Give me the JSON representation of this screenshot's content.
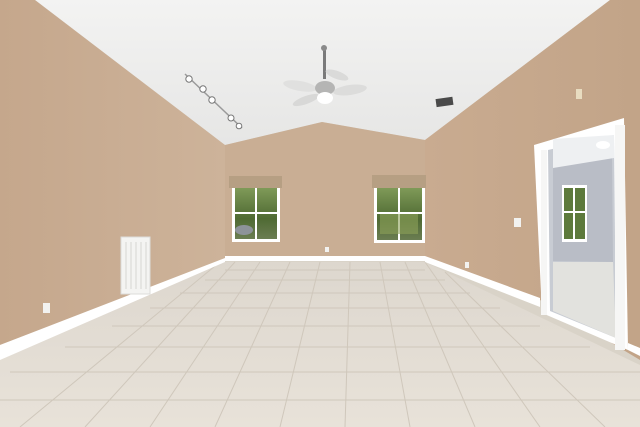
{
  "scene": {
    "kind": "photo-recreation",
    "elements": [
      "vaulted-ceiling",
      "ceiling-fan",
      "track-lighting",
      "left-wall",
      "back-wall",
      "right-wall",
      "window-left",
      "window-right",
      "roman-shade-left",
      "roman-shade-right",
      "air-return-vent",
      "ceiling-vent",
      "open-doorway",
      "tile-floor"
    ]
  },
  "colors": {
    "wall": "#c8ad93",
    "wall_shadow": "#b89f86",
    "ceiling": "#ededec",
    "tile": "#e4ddd2",
    "grout": "#cfc7bb",
    "trim": "#ffffff",
    "greenery": "#5e7a3c",
    "shade": "#b59f84",
    "adjacent_room": "#b8bcc6"
  }
}
